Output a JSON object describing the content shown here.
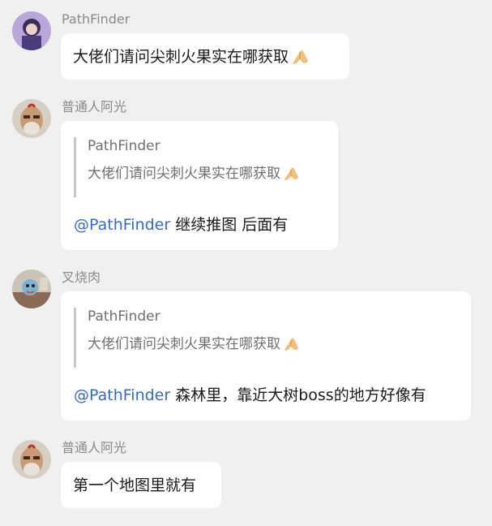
{
  "messages": [
    {
      "sender": "PathFinder",
      "text": "大佬们请问尖刺火果实在哪获取",
      "emoji": "folded-hands-emoji"
    },
    {
      "sender": "普通人阿光",
      "quote": {
        "sender": "PathFinder",
        "text": "大佬们请问尖刺火果实在哪获取",
        "emoji": "folded-hands-emoji"
      },
      "mention": "@PathFinder",
      "text": " 继续推图 后面有"
    },
    {
      "sender": "叉烧肉",
      "quote": {
        "sender": "PathFinder",
        "text": "大佬们请问尖刺火果实在哪获取",
        "emoji": "folded-hands-emoji"
      },
      "mention": "@PathFinder",
      "text": " 森林里，靠近大树boss的地方好像有"
    },
    {
      "sender": "普通人阿光",
      "text": "第一个地图里就有"
    }
  ],
  "colors": {
    "background": "#f0f0f0",
    "bubble": "#ffffff",
    "mention": "#3a6ab8",
    "sender_name": "#8a8a8a"
  }
}
